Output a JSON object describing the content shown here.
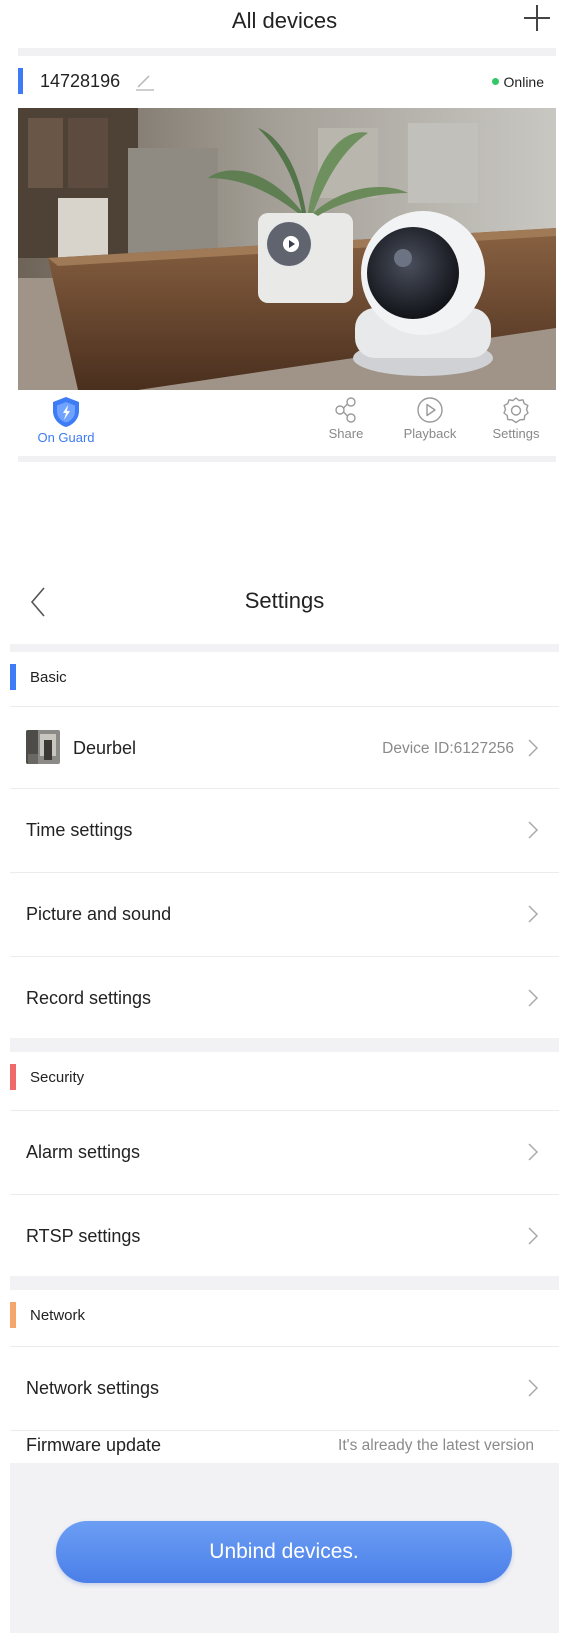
{
  "devices_page": {
    "title": "All devices",
    "add_icon": "plus-icon",
    "device": {
      "name": "14728196",
      "edit_icon": "pencil-icon",
      "status": "Online",
      "status_color": "#32c866",
      "accent_color": "#3e7bf6",
      "play_icon": "play-icon"
    },
    "actions": [
      {
        "label": "On Guard",
        "icon": "shield-icon",
        "active": true
      },
      {
        "label": "Share",
        "icon": "share-icon"
      },
      {
        "label": "Playback",
        "icon": "playback-icon"
      },
      {
        "label": "Settings",
        "icon": "gear-icon"
      }
    ]
  },
  "settings_page": {
    "title": "Settings",
    "back_icon": "chevron-left-icon",
    "sections": {
      "basic": {
        "label": "Basic",
        "color": "#3e7bf6",
        "device_row": {
          "name": "Deurbel",
          "device_id": "Device ID:6127256"
        },
        "rows": [
          "Time settings",
          "Picture and sound",
          "Record settings"
        ]
      },
      "security": {
        "label": "Security",
        "color": "#ef6b6b",
        "rows": [
          "Alarm settings",
          "RTSP settings"
        ]
      },
      "network": {
        "label": "Network",
        "color": "#f5a66a",
        "rows": [
          "Network settings"
        ],
        "firmware": {
          "label": "Firmware update",
          "value": "It's already the latest version"
        }
      }
    },
    "unbind_label": "Unbind devices."
  }
}
